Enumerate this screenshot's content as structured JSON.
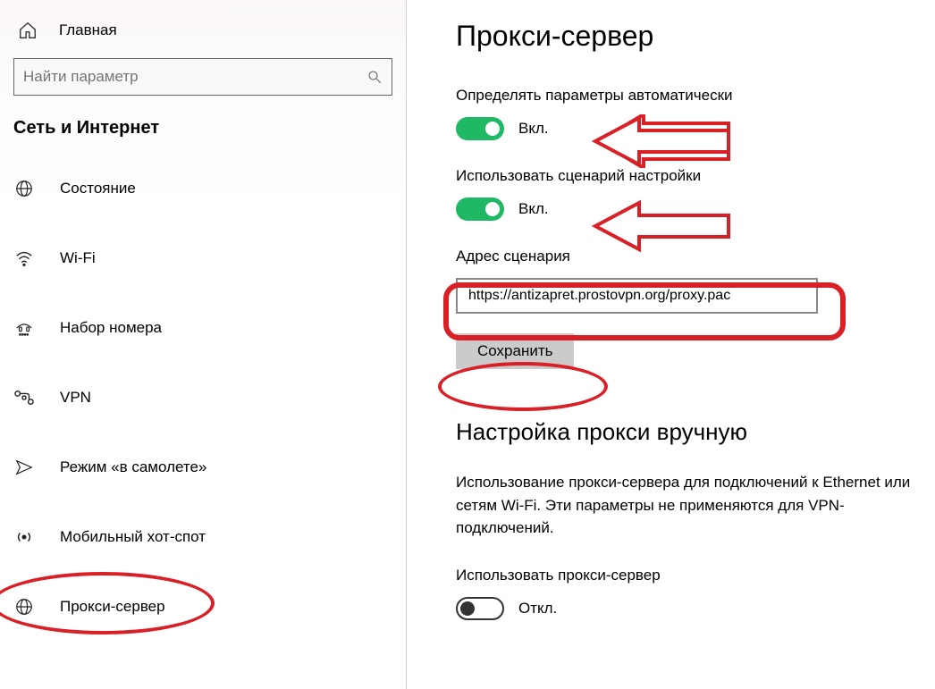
{
  "sidebar": {
    "home_label": "Главная",
    "search_placeholder": "Найти параметр",
    "section_title": "Сеть и Интернет",
    "items": [
      {
        "icon": "globe",
        "label": "Состояние"
      },
      {
        "icon": "wifi",
        "label": "Wi-Fi"
      },
      {
        "icon": "dialup",
        "label": "Набор номера"
      },
      {
        "icon": "vpn",
        "label": "VPN"
      },
      {
        "icon": "airplane",
        "label": "Режим «в самолете»"
      },
      {
        "icon": "hotspot",
        "label": "Мобильный хот-спот"
      },
      {
        "icon": "globe",
        "label": "Прокси-сервер"
      }
    ]
  },
  "main": {
    "title": "Прокси-сервер",
    "auto_detect_label": "Определять параметры автоматически",
    "auto_detect_state": "Вкл.",
    "use_script_label": "Использовать сценарий настройки",
    "use_script_state": "Вкл.",
    "script_address_label": "Адрес сценария",
    "script_address_value": "https://antizapret.prostovpn.org/proxy.pac",
    "save_button": "Сохранить",
    "manual_heading": "Настройка прокси вручную",
    "manual_description": "Использование прокси-сервера для подключений к Ethernet или сетям Wi-Fi. Эти параметры не применяются для VPN-подключений.",
    "use_proxy_label": "Использовать прокси-сервер",
    "use_proxy_state": "Откл."
  }
}
